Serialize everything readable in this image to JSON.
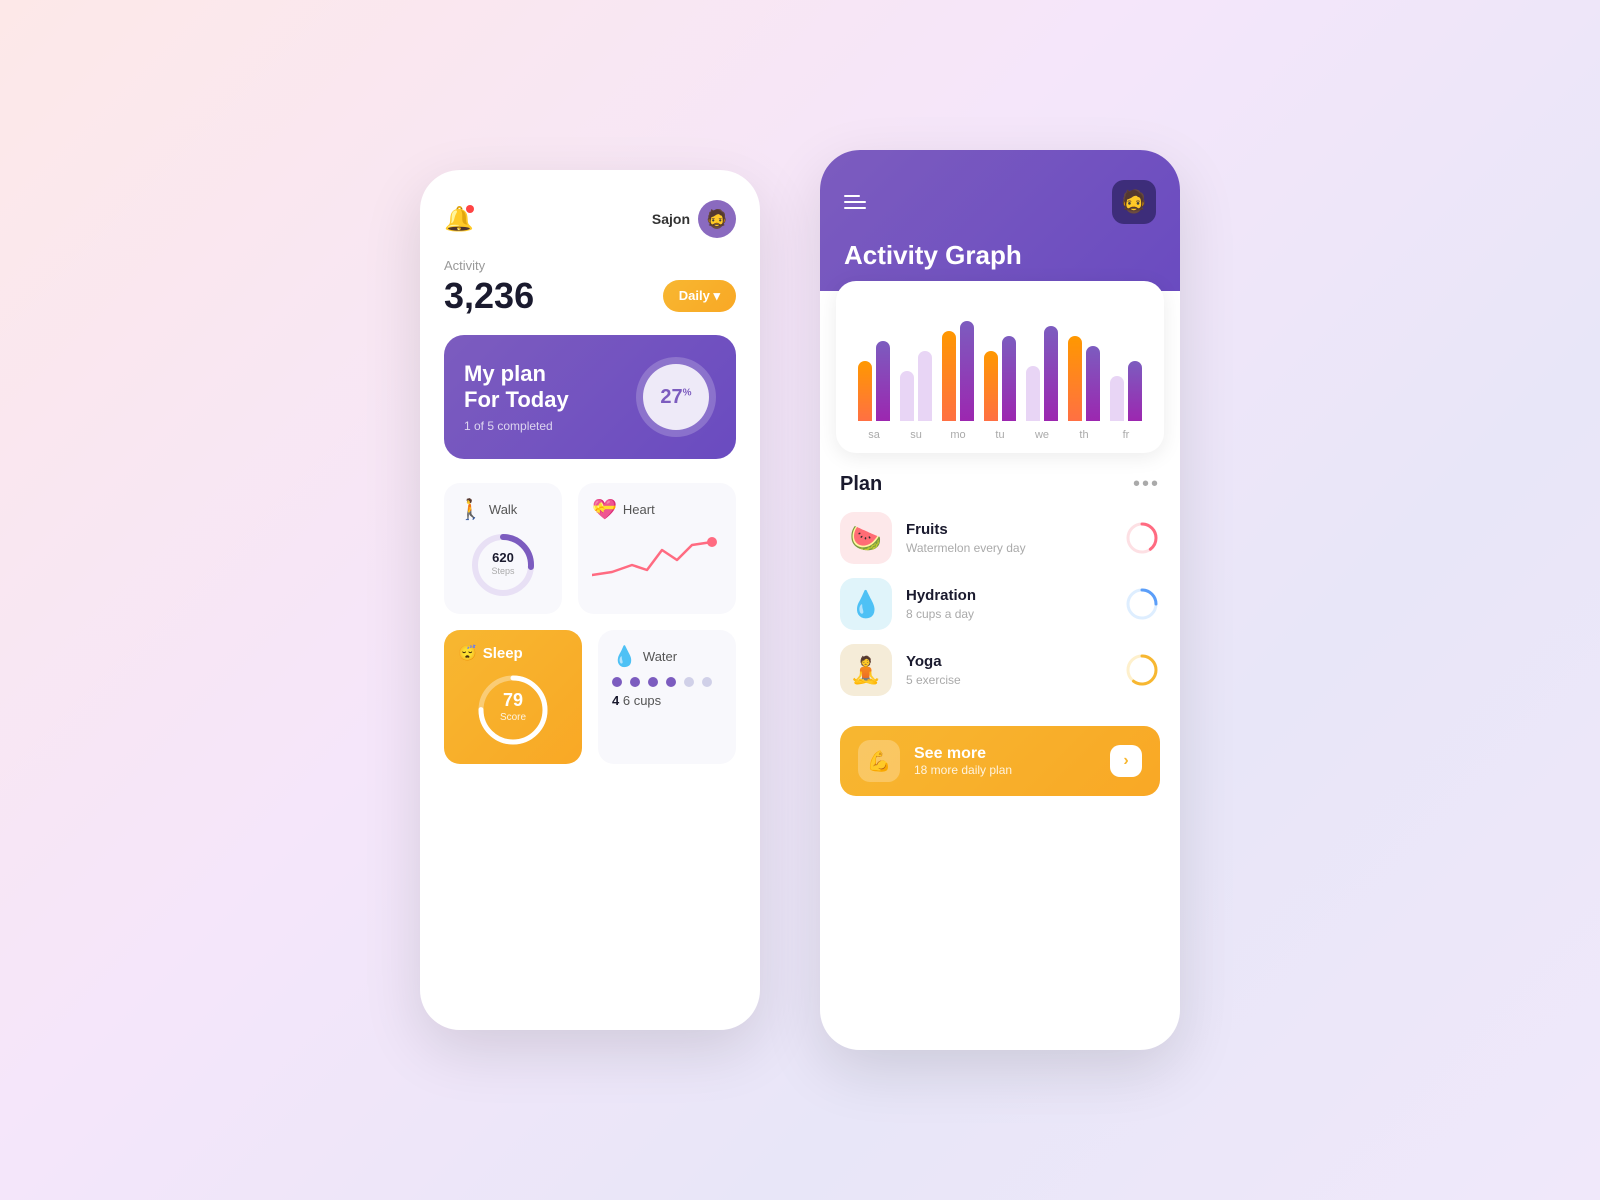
{
  "phone1": {
    "header": {
      "username": "Sajon",
      "avatarEmoji": "🧔"
    },
    "activity": {
      "label": "Activity",
      "value": "3,236",
      "daily_btn": "Daily ▾"
    },
    "plan": {
      "title": "My plan",
      "subtitle": "For Today",
      "progress": "1 of 5 completed",
      "percent": "27",
      "pct_symbol": "%"
    },
    "walk": {
      "label": "Walk",
      "emoji": "🚶",
      "value": "620",
      "unit": "Steps"
    },
    "heart": {
      "label": "Heart",
      "emoji": "💝"
    },
    "sleep": {
      "label": "Sleep",
      "emoji": "😴",
      "score": "79",
      "score_label": "Score"
    },
    "water": {
      "label": "Water",
      "emoji": "💧",
      "current": "4",
      "total": "6 cups",
      "filled_dots": 4,
      "total_dots": 6
    }
  },
  "phone2": {
    "header": {
      "title": "Activity Graph",
      "avatarEmoji": "🧔"
    },
    "chart": {
      "bars": [
        {
          "day": "sa",
          "orange": 60,
          "purple": 80
        },
        {
          "day": "su",
          "orange": 50,
          "purple": 70
        },
        {
          "day": "mo",
          "orange": 90,
          "purple": 100
        },
        {
          "day": "tu",
          "orange": 70,
          "purple": 85
        },
        {
          "day": "we",
          "orange": 55,
          "purple": 95
        },
        {
          "day": "th",
          "orange": 85,
          "purple": 75
        },
        {
          "day": "fr",
          "orange": 45,
          "purple": 60
        }
      ]
    },
    "plan": {
      "title": "Plan",
      "items": [
        {
          "icon": "🍉",
          "iconClass": "fruits",
          "title": "Fruits",
          "subtitle": "Watermelon every day",
          "ring_color": "#ff6b81",
          "ring_progress": 0.4
        },
        {
          "icon": "💧",
          "iconClass": "hydration",
          "title": "Hydration",
          "subtitle": "8 cups a day",
          "ring_color": "#5b9ef9",
          "ring_progress": 0.25
        },
        {
          "icon": "🧘",
          "iconClass": "yoga",
          "title": "Yoga",
          "subtitle": "5 exercise",
          "ring_color": "#f7b731",
          "ring_progress": 0.6
        }
      ]
    },
    "see_more": {
      "title": "See more",
      "subtitle": "18 more daily plan",
      "icon": "💪"
    }
  }
}
